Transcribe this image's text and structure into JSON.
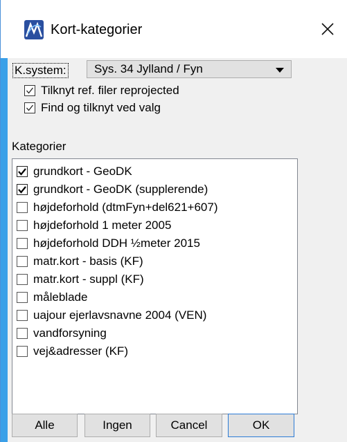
{
  "window": {
    "title": "Kort-kategorier"
  },
  "ksystem": {
    "label": "K.system:",
    "selected": "Sys. 34 Jylland / Fyn"
  },
  "options": [
    {
      "label": "Tilknyt ref. filer reprojected",
      "checked": true
    },
    {
      "label": "Find og tilknyt ved valg",
      "checked": true
    }
  ],
  "categories": {
    "label": "Kategorier",
    "items": [
      {
        "label": "grundkort - GeoDK",
        "checked": true
      },
      {
        "label": "grundkort - GeoDK (supplerende)",
        "checked": true
      },
      {
        "label": "højdeforhold (dtmFyn+del621+607)",
        "checked": false
      },
      {
        "label": "højdeforhold 1 meter 2005",
        "checked": false
      },
      {
        "label": "højdeforhold DDH ½meter 2015",
        "checked": false
      },
      {
        "label": "matr.kort - basis (KF)",
        "checked": false
      },
      {
        "label": "matr.kort - suppl (KF)",
        "checked": false
      },
      {
        "label": "måleblade",
        "checked": false
      },
      {
        "label": "uajour ejerlavsnavne 2004 (VEN)",
        "checked": false
      },
      {
        "label": "vandforsyning",
        "checked": false
      },
      {
        "label": "vej&adresser (KF)",
        "checked": false
      }
    ]
  },
  "buttons": {
    "all": "Alle",
    "none": "Ingen",
    "cancel": "Cancel",
    "ok": "OK"
  },
  "colors": {
    "accent": "#3aa0e8",
    "icon_bg": "#2a4fa0"
  }
}
